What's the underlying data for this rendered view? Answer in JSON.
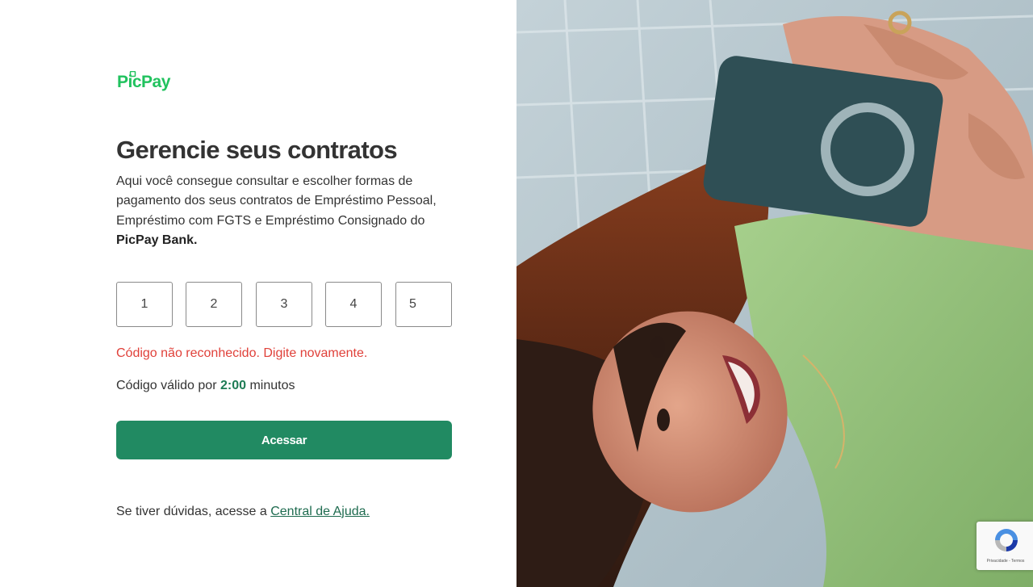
{
  "brand": {
    "name": "PicPay",
    "color": "#21c25e"
  },
  "main": {
    "title": "Gerencie seus contratos",
    "description_text": "Aqui você consegue consultar e escolher formas de pagamento dos seus contratos de Empréstimo Pessoal, Empréstimo com FGTS e Empréstimo Consignado do ",
    "description_bold": "PicPay Bank."
  },
  "code": {
    "digits": [
      "1",
      "2",
      "3",
      "4",
      "5"
    ]
  },
  "error_message": "Código não reconhecido. Digite novamente.",
  "timer": {
    "prefix": "Código válido por",
    "time": "2:00",
    "suffix": "minutos"
  },
  "submit_button": {
    "label": "Acessar",
    "color": "#218a62"
  },
  "help": {
    "text": "Se tiver dúvidas, acesse a",
    "link_label": "Central de Ajuda."
  },
  "recaptcha": {
    "text": "Privacidade - Termos"
  },
  "photo": {
    "icon": "woman-with-phone-photo"
  }
}
